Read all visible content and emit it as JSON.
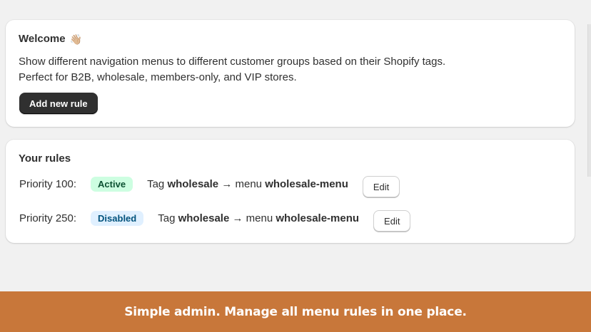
{
  "welcome": {
    "title": "Welcome",
    "emoji": "👋🏼",
    "line1": "Show different navigation menus to different customer groups based on their Shopify tags.",
    "line2": "Perfect for B2B, wholesale, members-only, and VIP stores.",
    "add_button_label": "Add new rule"
  },
  "rules": {
    "title": "Your rules",
    "items": [
      {
        "priority": "Priority 100:",
        "status": "Active",
        "tag_prefix": "Tag",
        "tag": "wholesale",
        "arrow_menu": "→ menu",
        "menu": "wholesale-menu",
        "edit_label": "Edit"
      },
      {
        "priority": "Priority 250:",
        "status": "Disabled",
        "tag_prefix": "Tag",
        "tag": "wholesale",
        "arrow_menu": "→ menu",
        "menu": "wholesale-menu",
        "edit_label": "Edit"
      }
    ]
  },
  "caption": "Simple admin. Manage all menu rules in one place.",
  "colors": {
    "background": "#f1f1f1",
    "card": "#ffffff",
    "primary_button": "#303030",
    "active_badge_bg": "#cdfee1",
    "active_badge_text": "#0c5132",
    "disabled_badge_bg": "#e0f0ff",
    "disabled_badge_text": "#00527c",
    "caption_bar": "#c8773a"
  }
}
